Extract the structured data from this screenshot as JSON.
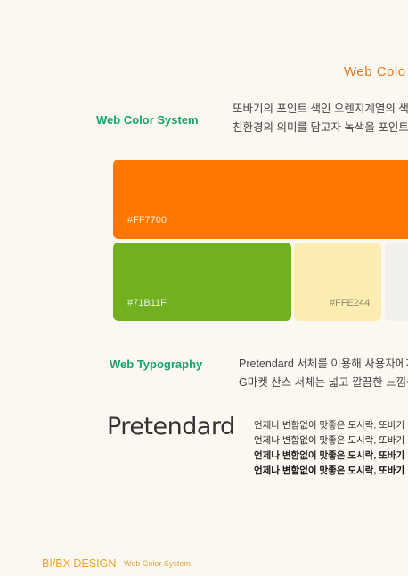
{
  "header": {
    "title": "Web Colo"
  },
  "color_section": {
    "label": "Web Color System",
    "desc_line1": "또바기의 포인트 색인 오렌지계열의 색상",
    "desc_line2": "친환경의 의미를 담고자 녹색을 포인트로"
  },
  "swatches": [
    {
      "name": "orange",
      "hex": "#FF7700",
      "color": "#ff7700"
    },
    {
      "name": "green",
      "hex": "#71B11F",
      "color": "#71b11f"
    },
    {
      "name": "yellow",
      "hex": "#FFE244",
      "color": "#fbedb1"
    },
    {
      "name": "gray",
      "hex": "",
      "color": "#f1f0ed"
    }
  ],
  "typo_section": {
    "label": "Web Typography",
    "desc_line1": "Pretendard 서체를 이용해 사용자에게",
    "desc_line2": "G마켓 산스 서체는 넓고 깔끔한 느낌을"
  },
  "font_demo": {
    "name": "Pretendard",
    "samples": [
      "언제나 변함없이 맛좋은 도시락, 또바기",
      "언제나 변함없이 맛좋은 도시락, 또바기",
      "언제나 변함없이 맛좋은 도시락, 또바기",
      "언제나 변함없이 맛좋은 도시락, 또바기"
    ]
  },
  "footer": {
    "brand": "BI/BX DESIGN",
    "sub": "Web Color System"
  }
}
